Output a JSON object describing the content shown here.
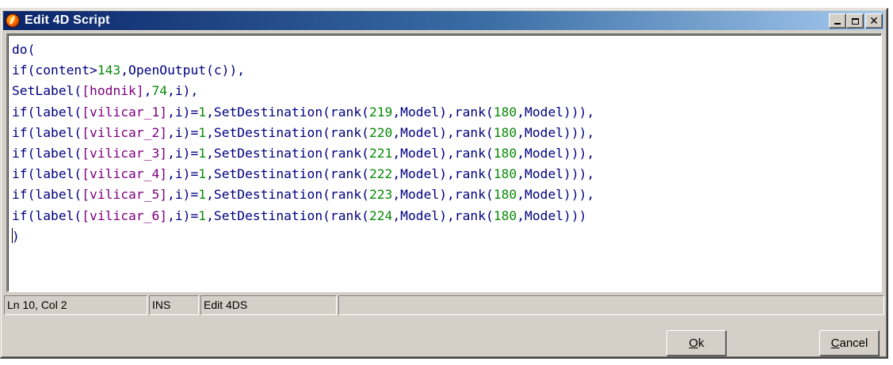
{
  "window": {
    "title": "Edit 4D Script",
    "icon": "4ds-app-icon",
    "controls": {
      "minimize": "minimize-icon",
      "maximize": "maximize-icon",
      "close_glyph": "✕"
    }
  },
  "editor": {
    "lines": [
      "do(",
      "if(content>143,OpenOutput(c)),",
      "SetLabel([hodnik],74,i),",
      "if(label([vilicar_1],i)=1,SetDestination(rank(219,Model),rank(180,Model))),",
      "if(label([vilicar_2],i)=1,SetDestination(rank(220,Model),rank(180,Model))),",
      "if(label([vilicar_3],i)=1,SetDestination(rank(221,Model),rank(180,Model))),",
      "if(label([vilicar_4],i)=1,SetDestination(rank(222,Model),rank(180,Model))),",
      "if(label([vilicar_5],i)=1,SetDestination(rank(223,Model),rank(180,Model))),",
      "if(label([vilicar_6],i)=1,SetDestination(rank(224,Model),rank(180,Model)))",
      ")"
    ],
    "cursor_line": 10,
    "colors": {
      "identifier": "#000080",
      "number": "#0a8a0a",
      "reference": "#800080"
    }
  },
  "status": {
    "position": "Ln 10, Col 2",
    "mode": "INS",
    "context": "Edit 4DS",
    "extra": ""
  },
  "buttons": {
    "ok_mnemonic": "O",
    "ok_rest": "k",
    "cancel_mnemonic": "C",
    "cancel_rest": "ancel"
  }
}
